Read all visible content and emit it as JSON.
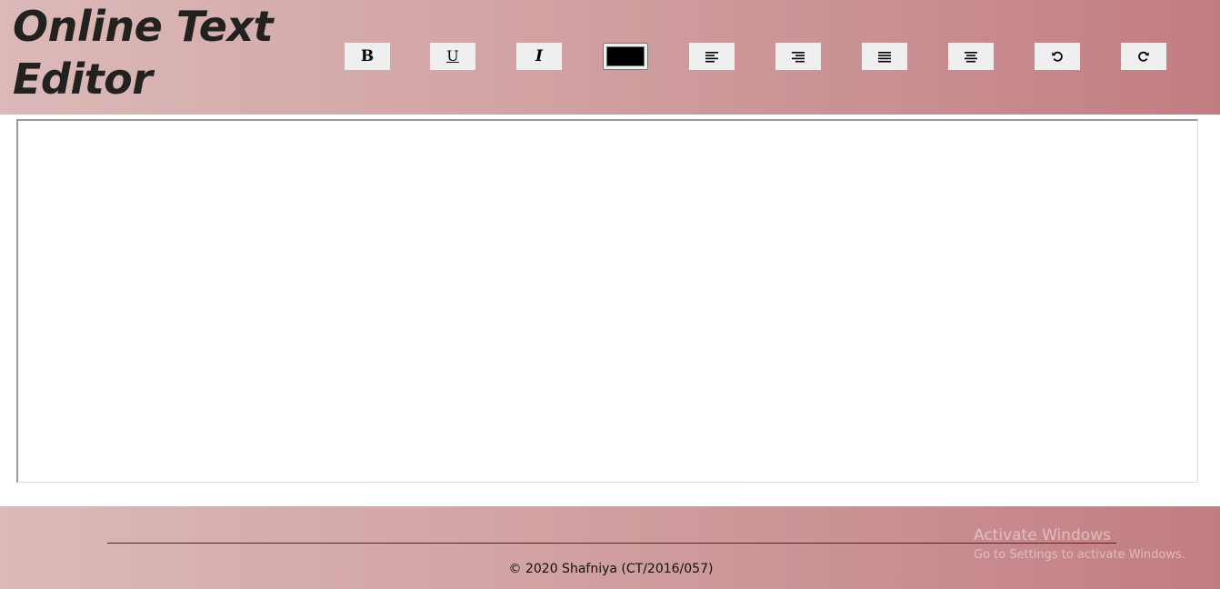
{
  "header": {
    "title": "Online Text Editor"
  },
  "toolbar": {
    "bold_label": "B",
    "underline_label": "U",
    "italic_label": "I",
    "color_value": "#000000",
    "buttons": [
      {
        "name": "bold",
        "icon": "bold-icon"
      },
      {
        "name": "underline",
        "icon": "underline-icon"
      },
      {
        "name": "italic",
        "icon": "italic-icon"
      },
      {
        "name": "text-color",
        "icon": "color-swatch"
      },
      {
        "name": "align-left",
        "icon": "align-left-icon"
      },
      {
        "name": "align-right",
        "icon": "align-right-icon"
      },
      {
        "name": "justify",
        "icon": "align-justify-icon"
      },
      {
        "name": "align-center",
        "icon": "align-center-icon"
      },
      {
        "name": "undo",
        "icon": "undo-icon"
      },
      {
        "name": "redo",
        "icon": "redo-icon"
      }
    ]
  },
  "editor": {
    "content": ""
  },
  "footer": {
    "copyright": "© 2020 Shafniya (CT/2016/057)"
  },
  "watermark": {
    "title": "Activate Windows",
    "subtitle": "Go to Settings to activate Windows."
  },
  "colors": {
    "header_gradient_start": "#dbb9b8",
    "header_gradient_end": "#c27d82",
    "button_bg": "#efefef",
    "title_text": "#232020"
  }
}
